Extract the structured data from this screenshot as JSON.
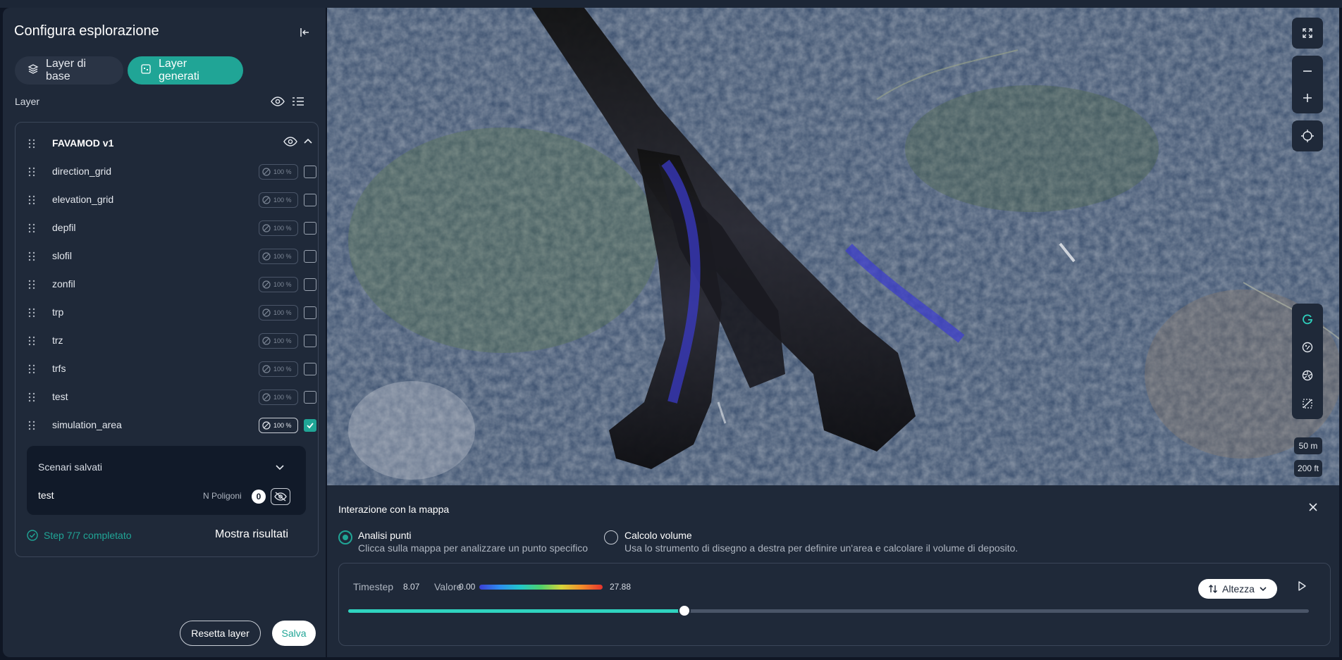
{
  "sidebar": {
    "title": "Configura esplorazione",
    "tabs": [
      {
        "label": "Layer di base"
      },
      {
        "label": "Layer generati"
      }
    ],
    "layer_heading": "Layer",
    "group": {
      "name": "FAVAMOD v1",
      "layers": [
        {
          "name": "direction_grid",
          "opacity": "100 %",
          "checked": false
        },
        {
          "name": "elevation_grid",
          "opacity": "100 %",
          "checked": false
        },
        {
          "name": "depfil",
          "opacity": "100 %",
          "checked": false
        },
        {
          "name": "slofil",
          "opacity": "100 %",
          "checked": false
        },
        {
          "name": "zonfil",
          "opacity": "100 %",
          "checked": false
        },
        {
          "name": "trp",
          "opacity": "100 %",
          "checked": false
        },
        {
          "name": "trz",
          "opacity": "100 %",
          "checked": false
        },
        {
          "name": "trfs",
          "opacity": "100 %",
          "checked": false
        },
        {
          "name": "test",
          "opacity": "100 %",
          "checked": false
        },
        {
          "name": "simulation_area",
          "opacity": "100 %",
          "checked": true
        }
      ]
    },
    "scenari": {
      "title": "Scenari salvati",
      "item_name": "test",
      "n_poligoni_label": "N Poligoni",
      "n_poligoni_count": "0"
    },
    "step_text": "Step 7/7 completato",
    "show_results": "Mostra risultati",
    "reset_label": "Resetta layer",
    "save_label": "Salva"
  },
  "map": {
    "scale_m": "50 m",
    "scale_ft": "200 ft"
  },
  "interaction": {
    "title": "Interazione con la mappa",
    "options": [
      {
        "title": "Analisi punti",
        "desc": "Clicca sulla mappa per analizzare un punto specifico",
        "selected": true
      },
      {
        "title": "Calcolo volume",
        "desc": "Usa lo strumento di disegno a destra per definire un'area e calcolare il volume di deposito.",
        "selected": false
      }
    ],
    "timestep_label": "Timestep",
    "timestep_value": "8.07",
    "valore_label": "Valore",
    "valore_min": "0.00",
    "valore_max": "27.88",
    "sort_label": "Altezza",
    "progress": 0.35
  },
  "colors": {
    "accent": "#20a596",
    "panel": "#1f2939"
  }
}
